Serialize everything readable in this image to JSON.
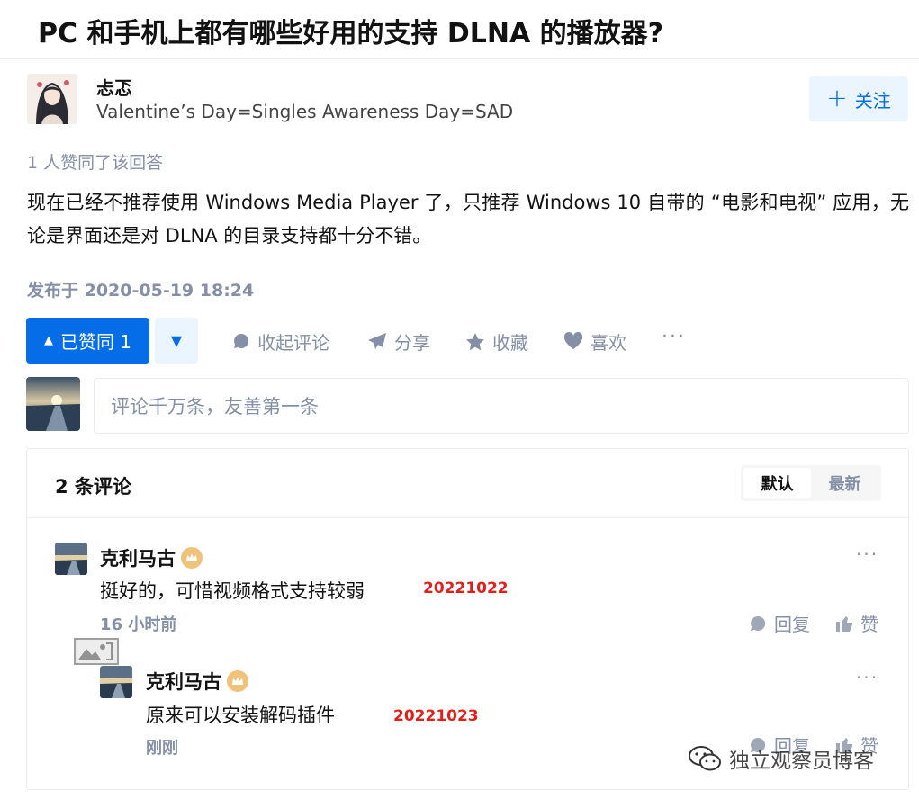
{
  "question": {
    "title": "PC 和手机上都有哪些好用的支持 DLNA 的播放器?"
  },
  "author": {
    "name": "忐忑",
    "bio": "Valentine’s Day=Singles Awareness Day=SAD",
    "follow_label": "关注"
  },
  "answer": {
    "vote_summary": "1 人赞同了该回答",
    "text": "现在已经不推荐使用 Windows Media Player 了，只推荐 Windows 10 自带的 “电影和电视” 应用，无论是界面还是对 DLNA 的目录支持都十分不错。",
    "published": "发布于 2020-05-19 18:24"
  },
  "actions": {
    "upvote_label": "已赞同 1",
    "collapse_comments": "收起评论",
    "share": "分享",
    "favorite": "收藏",
    "like": "喜欢",
    "more": "···"
  },
  "comment_input": {
    "placeholder": "评论千万条，友善第一条"
  },
  "comments_panel": {
    "count_label": "2 条评论",
    "sort_default": "默认",
    "sort_latest": "最新"
  },
  "comments": [
    {
      "author": "克利马古",
      "text": "挺好的，可惜视频格式支持较弱",
      "time": "16 小时前",
      "reply_label": "回复",
      "like_label": "赞",
      "annotation": "20221022"
    },
    {
      "author": "克利马古",
      "text": "原来可以安装解码插件",
      "time": "刚刚",
      "reply_label": "回复",
      "like_label": "赞",
      "annotation": "20221023"
    }
  ],
  "watermark": {
    "text": "独立观察员博客"
  },
  "colors": {
    "accent": "#056de8",
    "muted": "#8590a6",
    "annotation": "#e0201c"
  }
}
